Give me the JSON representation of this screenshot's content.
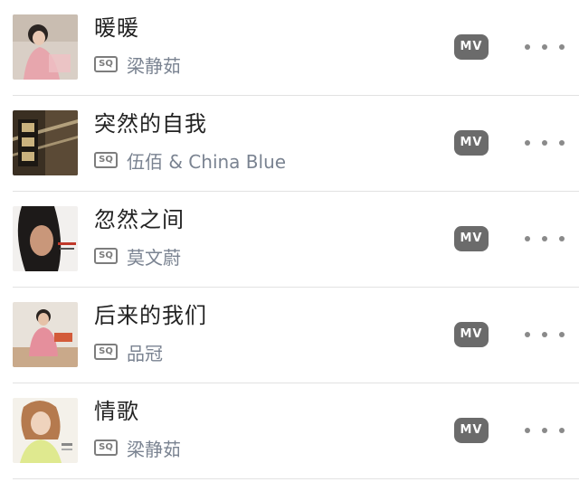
{
  "songs": [
    {
      "title": "暖暖",
      "quality": "SQ",
      "artist": "梁静茹",
      "mv_label": "MV",
      "cover_icon": "album-cover-icon"
    },
    {
      "title": "突然的自我",
      "quality": "SQ",
      "artist": "伍佰 & China Blue",
      "mv_label": "MV",
      "cover_icon": "album-cover-icon"
    },
    {
      "title": "忽然之间",
      "quality": "SQ",
      "artist": "莫文蔚",
      "mv_label": "MV",
      "cover_icon": "album-cover-icon"
    },
    {
      "title": "后来的我们",
      "quality": "SQ",
      "artist": "品冠",
      "mv_label": "MV",
      "cover_icon": "album-cover-icon"
    },
    {
      "title": "情歌",
      "quality": "SQ",
      "artist": "梁静茹",
      "mv_label": "MV",
      "cover_icon": "album-cover-icon"
    }
  ],
  "colors": {
    "title": "#222222",
    "artist": "#7a8391",
    "badge": "#6b6b6b",
    "separator": "#e2e2e2"
  }
}
